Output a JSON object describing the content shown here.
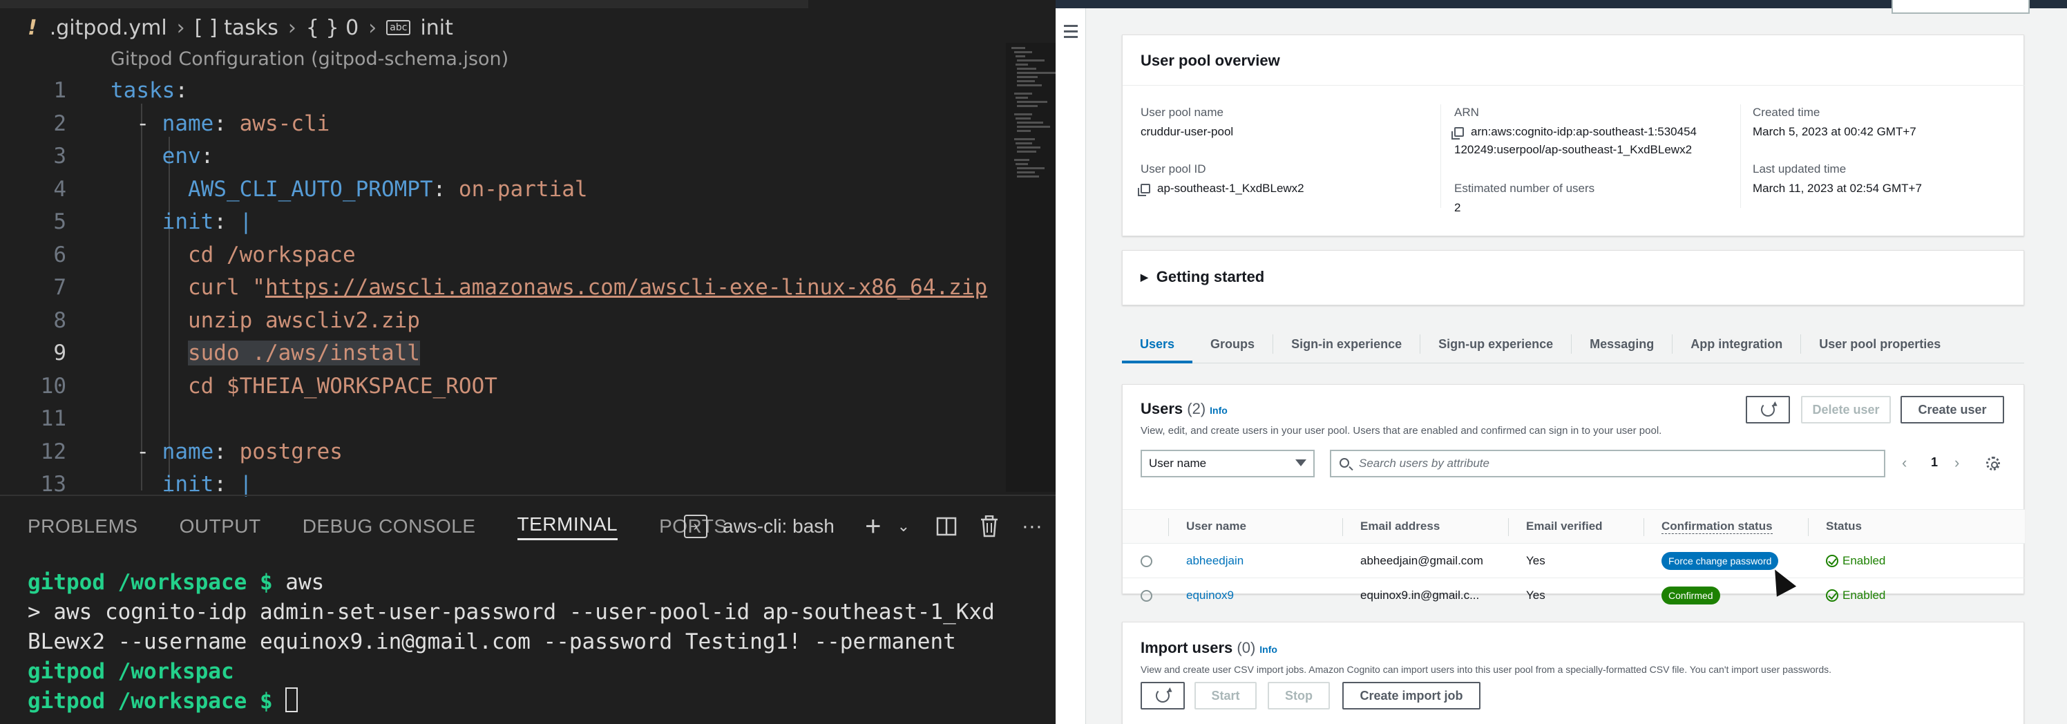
{
  "vscode": {
    "breadcrumb": {
      "file": ".gitpod.yml",
      "p1": "[ ] tasks",
      "p2": "{ } 0",
      "p3": "init"
    },
    "schema_hint": "Gitpod Configuration (gitpod-schema.json)",
    "lines": [
      {
        "n": "1",
        "t": "tasks:"
      },
      {
        "n": "2",
        "t": "  - name: aws-cli"
      },
      {
        "n": "3",
        "t": "    env:"
      },
      {
        "n": "4",
        "t": "      AWS_CLI_AUTO_PROMPT: on-partial"
      },
      {
        "n": "5",
        "t": "    init: |"
      },
      {
        "n": "6",
        "t": "      cd /workspace"
      },
      {
        "n": "7",
        "t": "      curl \"https://awscli.amazonaws.com/awscli-exe-linux-x86_64.zip"
      },
      {
        "n": "8",
        "t": "      unzip awscliv2.zip"
      },
      {
        "n": "9",
        "t": "      sudo ./aws/install"
      },
      {
        "n": "10",
        "t": "      cd $THEIA_WORKSPACE_ROOT"
      },
      {
        "n": "11",
        "t": ""
      },
      {
        "n": "12",
        "t": "  - name: postgres"
      },
      {
        "n": "13",
        "t": "    init: |"
      }
    ],
    "panel_tabs": [
      "PROBLEMS",
      "OUTPUT",
      "DEBUG CONSOLE",
      "TERMINAL",
      "PORTS"
    ],
    "terminal_name": "aws-cli: bash",
    "terminal": {
      "prompt1": "gitpod /workspace $ ",
      "cmd1": "aws",
      "line2": "> aws cognito-idp admin-set-user-password --user-pool-id ap-southeast-1_Kxd",
      "line3": "BLewx2 --username equinox9.in@gmail.com --password Testing1! --permanent",
      "line4": "gitpod /workspac",
      "prompt5": "gitpod /workspace $ "
    }
  },
  "aws": {
    "overview": {
      "title": "User pool overview",
      "pool_name_label": "User pool name",
      "pool_name": "cruddur-user-pool",
      "pool_id_label": "User pool ID",
      "pool_id": "ap-southeast-1_KxdBLewx2",
      "arn_label": "ARN",
      "arn_1": "arn:aws:cognito-idp:ap-southeast-1:530454",
      "arn_2": "120249:userpool/ap-southeast-1_KxdBLewx2",
      "est_users_label": "Estimated number of users",
      "est_users": "2",
      "created_label": "Created time",
      "created": "March 5, 2023 at 00:42 GMT+7",
      "updated_label": "Last updated time",
      "updated": "March 11, 2023 at 02:54 GMT+7"
    },
    "getting_started": "Getting started",
    "tabs": [
      "Users",
      "Groups",
      "Sign-in experience",
      "Sign-up experience",
      "Messaging",
      "App integration",
      "User pool properties"
    ],
    "users": {
      "title": "Users",
      "count": "(2)",
      "info": "Info",
      "description": "View, edit, and create users in your user pool. Users that are enabled and confirmed can sign in to your user pool.",
      "delete_btn": "Delete user",
      "create_btn": "Create user",
      "filter_select": "User name",
      "search_placeholder": "Search users by attribute",
      "page": "1",
      "columns": [
        "User name",
        "Email address",
        "Email verified",
        "Confirmation status",
        "Status"
      ],
      "rows": [
        {
          "user": "abheedjain",
          "email": "abheedjain@gmail.com",
          "verified": "Yes",
          "confirmation": "Force change password",
          "status": "Enabled"
        },
        {
          "user": "equinox9",
          "email": "equinox9.in@gmail.c...",
          "verified": "Yes",
          "confirmation": "Confirmed",
          "status": "Enabled"
        }
      ]
    },
    "import": {
      "title": "Import users",
      "count": "(0)",
      "info": "Info",
      "description": "View and create user CSV import jobs. Amazon Cognito can import users into this user pool from a specially-formatted CSV file. You can't import user passwords.",
      "start": "Start",
      "stop": "Stop",
      "create": "Create import job"
    },
    "colors": {
      "link": "#0073bb",
      "badge_blue": "#0073bb",
      "badge_green": "#1d8102"
    }
  }
}
